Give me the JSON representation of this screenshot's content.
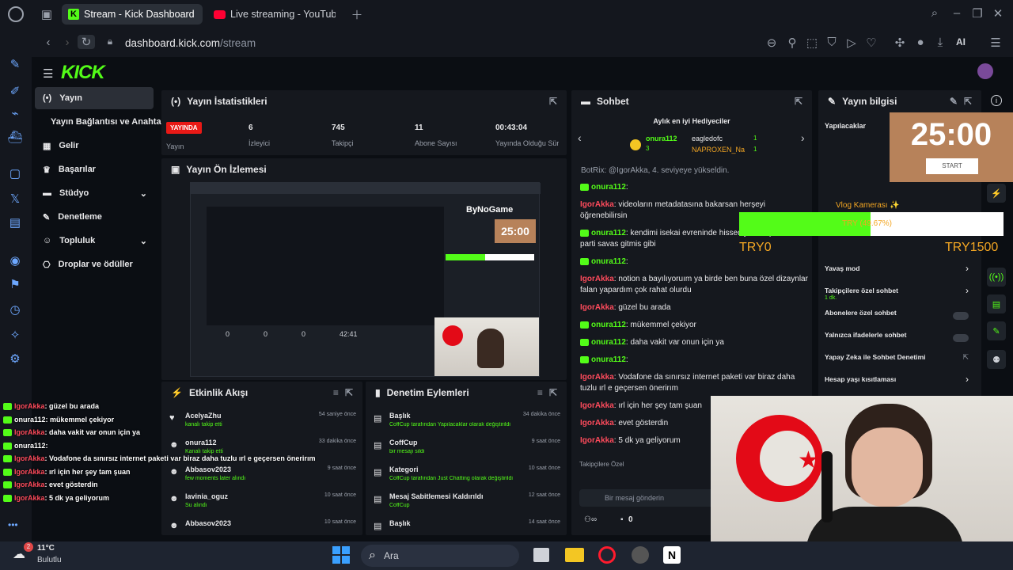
{
  "browser": {
    "tabs": [
      {
        "label": "Stream - Kick Dashboard"
      },
      {
        "label": "Live streaming - YouTube"
      }
    ],
    "url_host": "dashboard.kick.com",
    "url_path": "/stream",
    "ai_label": "AI"
  },
  "sidebar": {
    "items": [
      {
        "label": "Yayın"
      },
      {
        "label": "Yayın Bağlantısı ve Anahtarı"
      },
      {
        "label": "Gelir"
      },
      {
        "label": "Başarılar"
      },
      {
        "label": "Stüdyo"
      },
      {
        "label": "Denetleme"
      },
      {
        "label": "Topluluk"
      },
      {
        "label": "Droplar ve ödüller"
      }
    ]
  },
  "stats": {
    "title": "Yayın İstatistikleri",
    "live_badge": "YAYINDA",
    "live_label": "Yayın",
    "viewers": "6",
    "viewers_label": "İzleyici",
    "followers": "745",
    "followers_label": "Takipçi",
    "subs": "11",
    "subs_label": "Abone Sayısı",
    "uptime": "00:43:04",
    "uptime_label": "Yayında Olduğu Süre"
  },
  "preview": {
    "title": "Yayın Ön İzlemesi",
    "timer": "25:00",
    "stat_0": "0",
    "stat_1": "0",
    "stat_2": "0",
    "stat_3": "42:41",
    "brand": "ByNoGame"
  },
  "activity": {
    "title": "Etkinlik Akışı",
    "items": [
      {
        "name": "AcelyaZhu",
        "sub": "kanalı takip etti",
        "time": "54 saniye önce"
      },
      {
        "name": "onura112",
        "sub": "Kanalı takip etti",
        "time": "33 dakika önce"
      },
      {
        "name": "Abbasov2023",
        "sub": "few moments later alındı",
        "time": "9 saat önce"
      },
      {
        "name": "lavinia_oguz",
        "sub": "Su alındı",
        "time": "10 saat önce"
      },
      {
        "name": "Abbasov2023",
        "sub": "",
        "time": "10 saat önce"
      }
    ]
  },
  "moderation": {
    "title": "Denetim Eylemleri",
    "items": [
      {
        "name": "Başlık",
        "sub": "CoffCup tarafından Yapılacaklar olarak değiştirildi",
        "time": "34 dakika önce"
      },
      {
        "name": "CoffCup",
        "sub": "bir mesajı sildi",
        "time": "9 saat önce"
      },
      {
        "name": "Kategori",
        "sub": "CoffCup tarafından Just Chatting olarak değiştirildi",
        "time": "10 saat önce"
      },
      {
        "name": "Mesaj Sabitlemesi Kaldırıldı",
        "sub": "CoffCup",
        "time": "12 saat önce"
      },
      {
        "name": "Başlık",
        "sub": "",
        "time": "14 saat önce"
      }
    ]
  },
  "chat": {
    "title": "Sohbet",
    "gifters_title": "Aylık en iyi Hediyeciler",
    "gifters": [
      {
        "name": "onura112",
        "count": "3"
      },
      {
        "name": "eagledofc",
        "count": "1"
      },
      {
        "name": "NAPROXEN_Na",
        "count": "1"
      }
    ],
    "top_line": "BotRix: @IgorAkka, 4. seviyeye yükseldin.",
    "messages": [
      {
        "user": "onura112",
        "text": "",
        "badge": true
      },
      {
        "user": "IgorAkka",
        "text": "videoların metadatasına bakarsan herşeyi öğrenebilirsin",
        "badge": false
      },
      {
        "user": "onura112",
        "text": "kendimi isekai evreninde hissediyorum şarkıdan parti savas gitmis gibi",
        "badge": true
      },
      {
        "user": "onura112",
        "text": "",
        "badge": true
      },
      {
        "user": "IgorAkka",
        "text": "notion a bayılıyoruım ya birde ben buna özel dizaynlar falan yapardım çok rahat olurdu",
        "badge": false
      },
      {
        "user": "IgorAkka",
        "text": "güzel bu arada",
        "badge": false
      },
      {
        "user": "onura112",
        "text": "mükemmel çekiyor",
        "badge": true
      },
      {
        "user": "onura112",
        "text": "daha vakit var onun için ya",
        "badge": true
      },
      {
        "user": "onura112",
        "text": "",
        "badge": true
      },
      {
        "user": "IgorAkka",
        "text": "Vodafone da sınırsız internet paketi var biraz daha tuzlu ırl e geçersen önerirım",
        "badge": false
      },
      {
        "user": "IgorAkka",
        "text": "ırl için her şey tam şuan",
        "badge": false
      },
      {
        "user": "IgorAkka",
        "text": "evet gösterdin",
        "badge": false
      },
      {
        "user": "IgorAkka",
        "text": "5 dk ya geliyorum",
        "badge": false
      }
    ],
    "followers_only": "Takipçilere Özel",
    "input_placeholder": "Bir mesaj gönderin",
    "viewer_count": "0"
  },
  "streaminfo": {
    "title": "Yayın bilgisi",
    "todo": "Yapılacaklar",
    "timer": "25:00",
    "start": "START",
    "goal_title": "Vlog Kamerası ✨",
    "goal_percent": "TRY (49.67%)",
    "goal_fraction": 0.4967,
    "goal_current": "TRY0",
    "goal_target": "TRY1500",
    "settings": [
      {
        "label": "Yavaş mod",
        "control": "arrow"
      },
      {
        "label": "Takipçilere özel sohbet",
        "sub": "1 dk.",
        "control": "arrow"
      },
      {
        "label": "Abonelere özel sohbet",
        "control": "toggle"
      },
      {
        "label": "Yalnızca ifadelerle sohbet",
        "control": "toggle"
      },
      {
        "label": "Yapay Zeka ile Sohbet Denetimi",
        "control": "link"
      },
      {
        "label": "Hesap yaşı kısıtlaması",
        "control": "arrow"
      }
    ]
  },
  "overlay_chat": [
    {
      "user": "IgorAkka",
      "text": ": güzel bu arada"
    },
    {
      "user": "onura112",
      "text": ": mükemmel çekiyor"
    },
    {
      "user": "IgorAkka",
      "text": ": daha vakit var onun için ya"
    },
    {
      "user": "onura112",
      "text": ":"
    },
    {
      "user": "IgorAkka",
      "text": ": Vodafone da sınırsız internet paketi var biraz daha tuzlu ırl e geçersen önerirım"
    },
    {
      "user": "IgorAkka",
      "text": ": ırl için her şey tam şuan"
    },
    {
      "user": "IgorAkka",
      "text": ": evet gösterdin"
    },
    {
      "user": "IgorAkka",
      "text": ": 5 dk ya geliyorum"
    }
  ],
  "taskbar": {
    "temp": "11°C",
    "weather": "Bulutlu",
    "search": "Ara",
    "notif": "2"
  },
  "colors": {
    "kick_green": "#53fc18",
    "live_red": "#e91916",
    "panel": "#15181e"
  }
}
